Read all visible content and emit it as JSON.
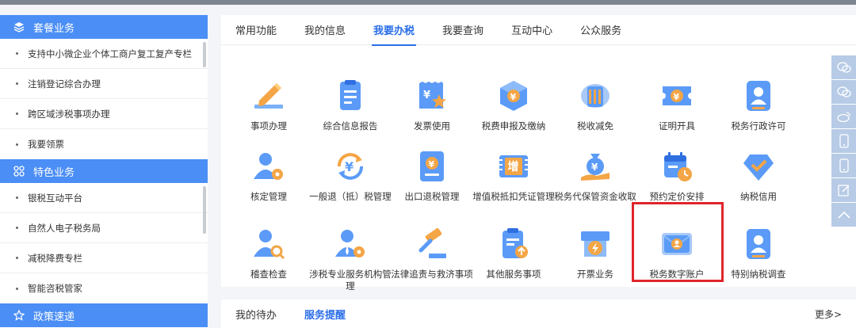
{
  "sidebar": {
    "sections": [
      {
        "title": "套餐业务",
        "items": [
          "支持中小微企业个体工商户复工复产专栏",
          "注销登记综合办理",
          "跨区域涉税事项办理",
          "我要领票"
        ]
      },
      {
        "title": "特色业务",
        "items": [
          "银税互动平台",
          "自然人电子税务局",
          "减税降费专栏",
          "智能咨税管家"
        ]
      },
      {
        "title": "政策速递",
        "items": []
      }
    ]
  },
  "main": {
    "tabs": [
      "常用功能",
      "我的信息",
      "我要办税",
      "我要查询",
      "互动中心",
      "公众服务"
    ],
    "active_tab": "我要办税",
    "grid": [
      [
        "事项办理",
        "综合信息报告",
        "发票使用",
        "税费申报及缴纳",
        "税收减免",
        "证明开具",
        "税务行政许可"
      ],
      [
        "核定管理",
        "一般退（抵）税管理",
        "出口退税管理",
        "增值税抵扣凭证管理",
        "税务代保管资金收取",
        "预约定价安排",
        "纳税信用"
      ],
      [
        "稽查检查",
        "涉税专业服务机构管理",
        "法律追责与救济事项",
        "其他服务事项",
        "开票业务",
        "税务数字账户",
        "特别纳税调查"
      ]
    ],
    "highlighted_item": "税务数字账户",
    "badge_text": "增"
  },
  "bottom": {
    "tabs": [
      "我的待办",
      "服务提醒"
    ],
    "active_tab": "服务提醒",
    "more_label": "更多>"
  },
  "float_toolbar": [
    "wechat-icon",
    "wechat-icon",
    "weibo-icon",
    "mobile-icon",
    "mobile-icon",
    "edit-icon",
    "chevron-up-icon"
  ],
  "colors": {
    "accent": "#2b6ee8",
    "section_header": "#4b8ef5",
    "highlight_box": "#e0252b"
  }
}
